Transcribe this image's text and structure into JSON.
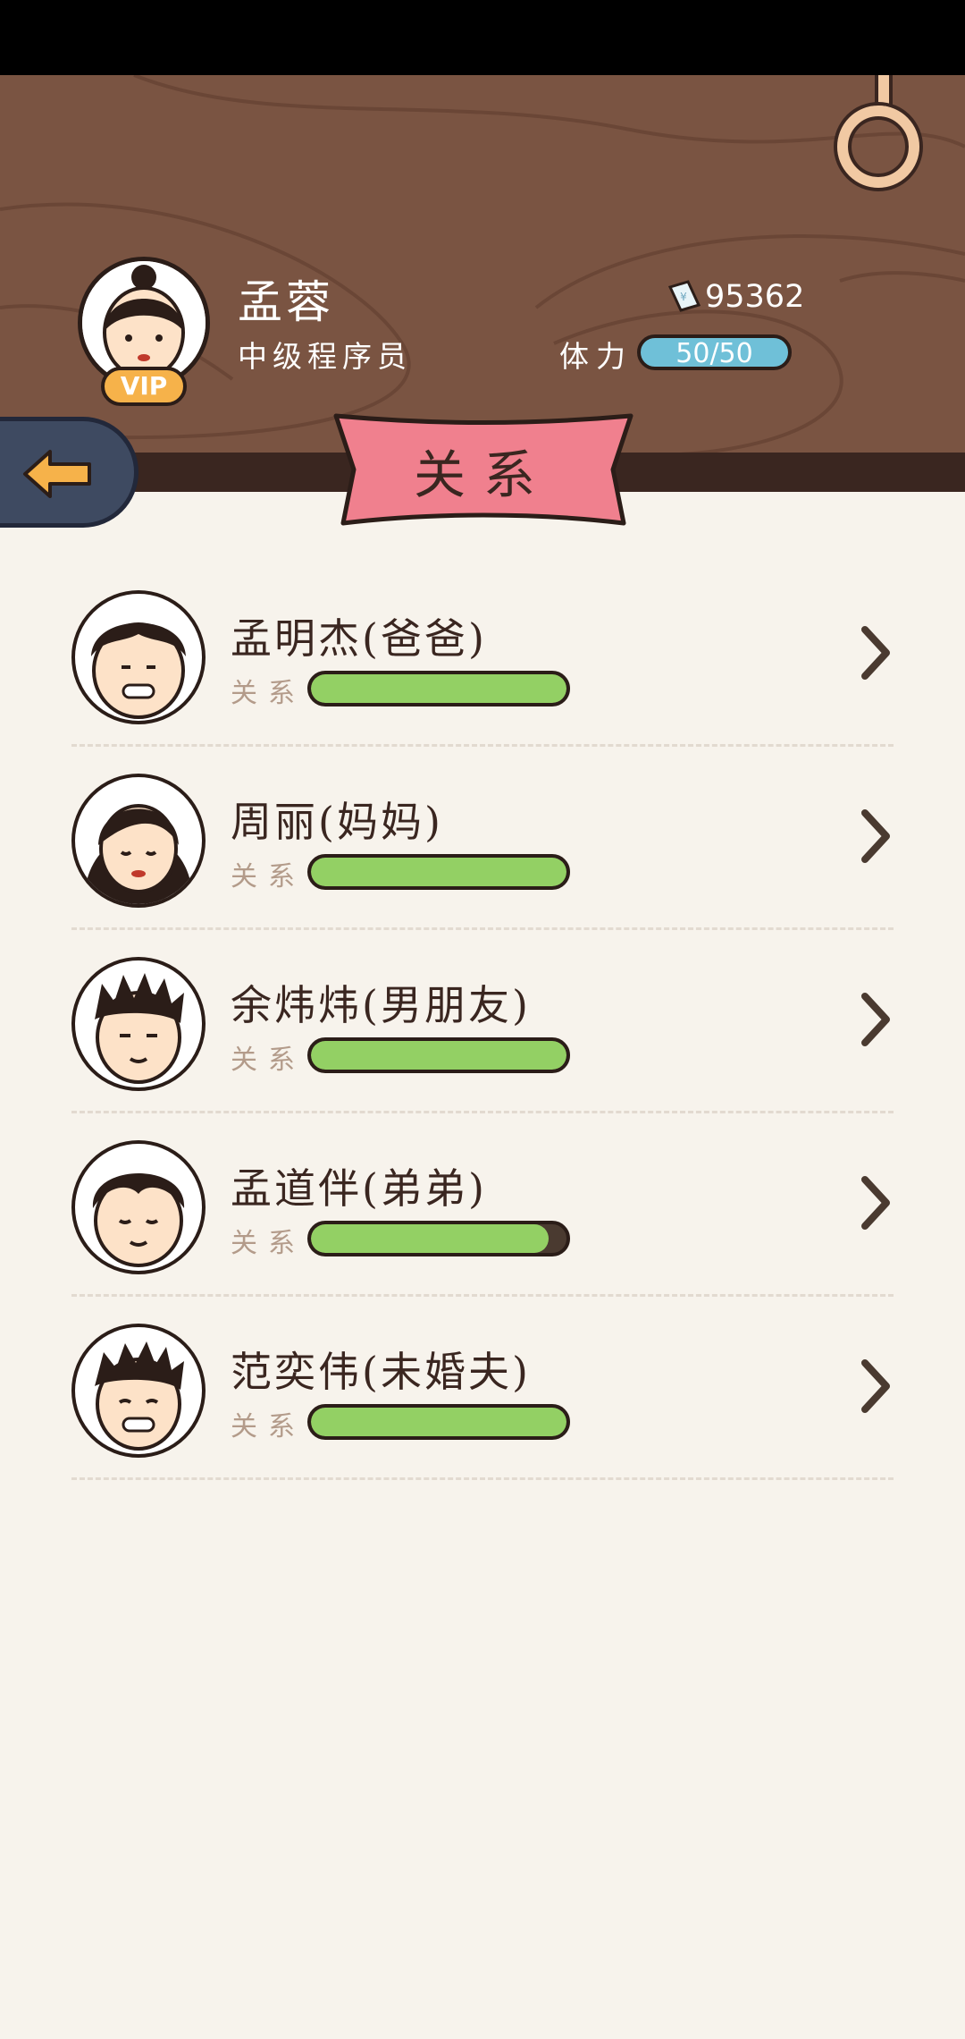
{
  "header": {
    "player_name": "孟蓉",
    "player_title": "中级程序员",
    "vip_label": "VIP",
    "money": "95362",
    "money_icon": "money-icon",
    "stamina_label": "体力",
    "stamina_value": "50/50"
  },
  "page_title": "关系",
  "relations": [
    {
      "name": "孟明杰(爸爸)",
      "label": "关系",
      "level": 1.0,
      "avatar": "father"
    },
    {
      "name": "周丽(妈妈)",
      "label": "关系",
      "level": 1.0,
      "avatar": "mother"
    },
    {
      "name": "余炜炜(男朋友)",
      "label": "关系",
      "level": 1.0,
      "avatar": "boyfriend"
    },
    {
      "name": "孟道伴(弟弟)",
      "label": "关系",
      "level": 0.93,
      "avatar": "brother"
    },
    {
      "name": "范奕伟(未婚夫)",
      "label": "关系",
      "level": 1.0,
      "avatar": "fiance"
    }
  ],
  "colors": {
    "header_bg": "#7a5442",
    "banner": "#f0808e",
    "bar_fill": "#93d064",
    "stamina": "#6fc0d8",
    "vip": "#f6b24a"
  }
}
